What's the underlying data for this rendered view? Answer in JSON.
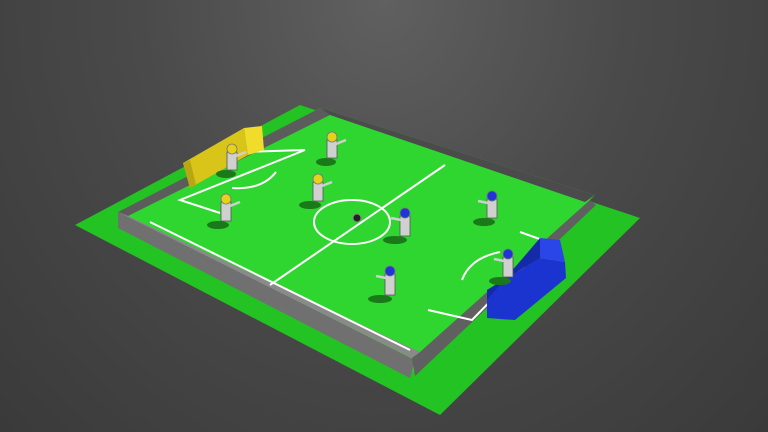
{
  "scene": {
    "type": "robot-soccer-3d",
    "colors": {
      "background_top": "#606060",
      "background_bottom": "#3a3a3a",
      "carpet": "#22c322",
      "field": "#2fd62f",
      "lines": "#ffffff",
      "walls": "#666666",
      "wall_edges": "#555555",
      "team_left": "#e6d21a",
      "team_right": "#1f35d8",
      "goal_left": "#e0cd18",
      "goal_right": "#1f3bd8",
      "robot_body": "#d0d0d0"
    },
    "teams": [
      {
        "name": "yellow-team",
        "players": 4
      },
      {
        "name": "blue-team",
        "players": 4
      }
    ],
    "objects": [
      "field",
      "walls",
      "yellow-goal",
      "blue-goal",
      "ball",
      "center-circle",
      "penalty-areas"
    ]
  }
}
